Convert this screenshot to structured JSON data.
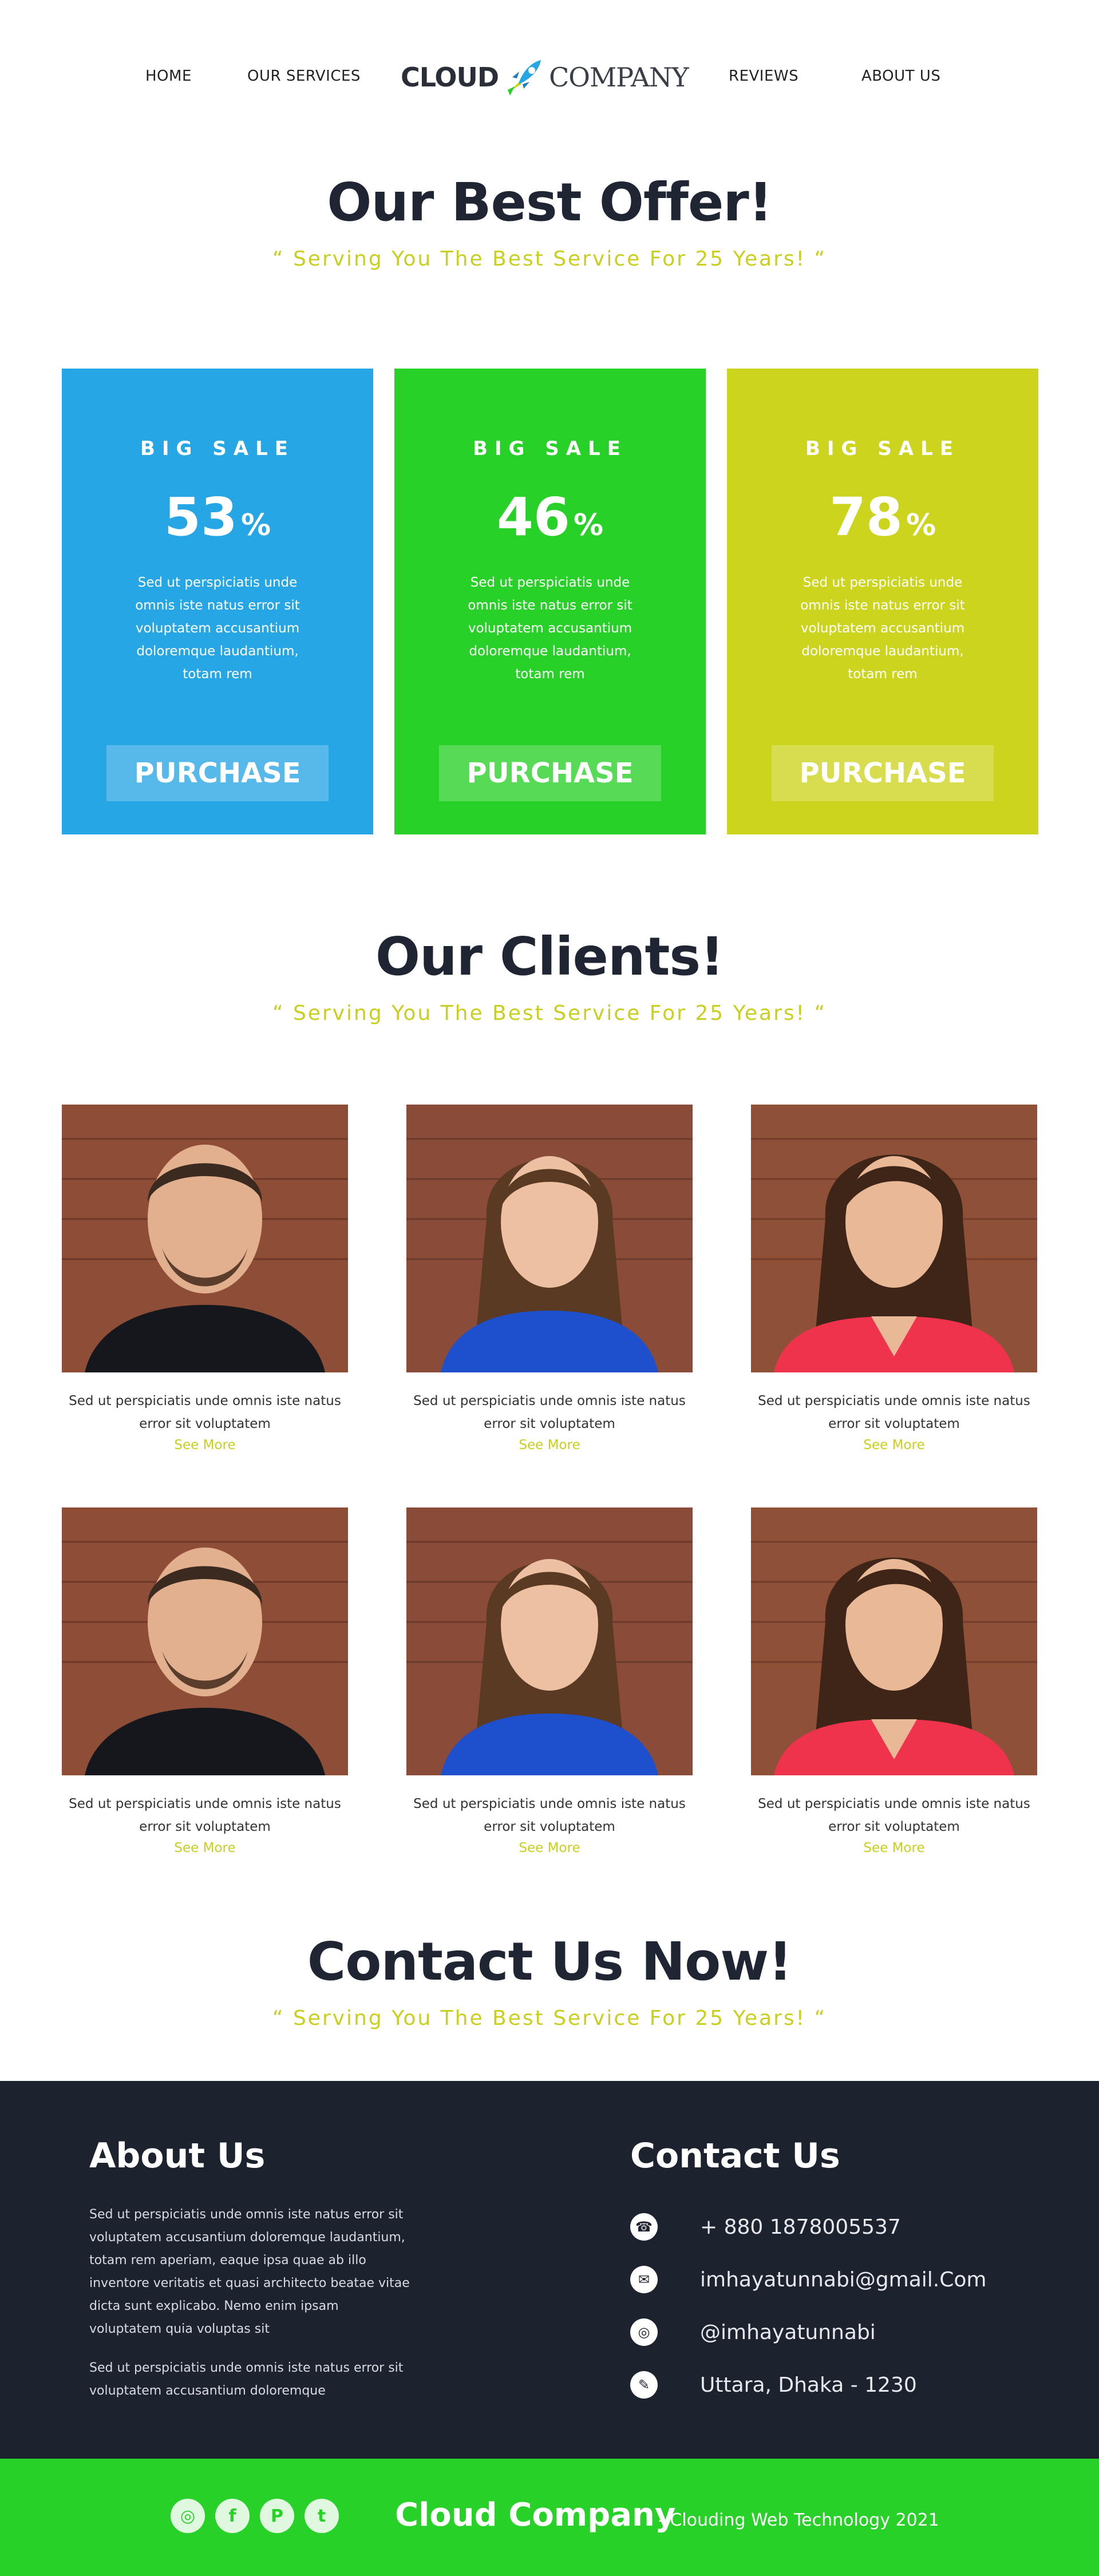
{
  "nav": {
    "home": "HOME",
    "services": "OUR SERVICES",
    "reviews": "REVIEWS",
    "about": "ABOUT US",
    "logo_left": "CLOUD",
    "logo_right": "COMPANY"
  },
  "offers": {
    "title": "Our Best Offer!",
    "subtitle": "“ Serving You The Best Service For 25 Years! “",
    "cards": [
      {
        "label": "BIG SALE",
        "percent": "53",
        "symbol": "%",
        "description": "Sed ut perspiciatis unde omnis iste natus error sit voluptatem accusantium doloremque laudantium, totam rem",
        "button": "PURCHASE",
        "color": "#27a6e5"
      },
      {
        "label": "BIG SALE",
        "percent": "46",
        "symbol": "%",
        "description": "Sed ut perspiciatis unde omnis iste natus error sit voluptatem accusantium doloremque laudantium, totam rem",
        "button": "PURCHASE",
        "color": "#28d128"
      },
      {
        "label": "BIG SALE",
        "percent": "78",
        "symbol": "%",
        "description": "Sed ut perspiciatis unde omnis iste natus error sit voluptatem accusantium doloremque laudantium, totam rem",
        "button": "PURCHASE",
        "color": "#cdd41e"
      }
    ]
  },
  "clients": {
    "title": "Our Clients!",
    "subtitle": "“ Serving You The Best Service For 25 Years! “",
    "items": [
      {
        "text": "Sed ut perspiciatis unde omnis iste natus error sit voluptatem",
        "link": "See More"
      },
      {
        "text": "Sed ut perspiciatis unde omnis iste natus error sit voluptatem",
        "link": "See More"
      },
      {
        "text": "Sed ut perspiciatis unde omnis iste natus error sit voluptatem",
        "link": "See More"
      },
      {
        "text": "Sed ut perspiciatis unde omnis iste natus error sit voluptatem",
        "link": "See More"
      },
      {
        "text": "Sed ut perspiciatis unde omnis iste natus error sit voluptatem",
        "link": "See More"
      },
      {
        "text": "Sed ut perspiciatis unde omnis iste natus error sit voluptatem",
        "link": "See More"
      }
    ]
  },
  "contact_section": {
    "title": "Contact Us Now!",
    "subtitle": "“ Serving You The Best Service For 25 Years! “"
  },
  "footer": {
    "about_title": "About Us",
    "about_text": "Sed ut perspiciatis unde omnis iste natus error sit voluptatem accusantium doloremque laudantium, totam rem aperiam, eaque ipsa quae ab illo inventore veritatis et quasi architecto beatae vitae dicta sunt explicabo. Nemo enim ipsam voluptatem quia voluptas sit",
    "about_text2": "Sed ut perspiciatis unde omnis iste natus error sit voluptatem accusantium doloremque",
    "contact_title": "Contact Us",
    "phone": "+ 880 1878005537",
    "email": "imhayatunnabi@gmail.Com",
    "instagram": "@imhayatunnabi",
    "address": "Uttara, Dhaka - 1230",
    "icons": [
      "phone-icon",
      "mail-icon",
      "instagram-icon",
      "pin-icon"
    ]
  },
  "bottom_bar": {
    "brand": "Cloud Company",
    "tagline": "- Clouding Web Technology 2021",
    "social_icons": [
      "instagram-icon",
      "facebook-icon",
      "pinterest-icon",
      "twitter-icon"
    ]
  },
  "colors": {
    "dark": "#1d222f",
    "green": "#28d128",
    "blue": "#27a6e5",
    "lime": "#cdd41e",
    "accent_text": "#c9cf1e"
  }
}
